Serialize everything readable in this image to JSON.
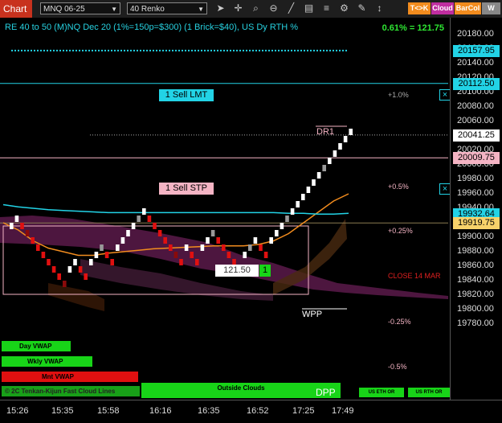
{
  "toolbar": {
    "chart_button": "Chart",
    "symbol": "MNQ 06-25",
    "chart_type": "40 Renko",
    "icons": [
      "pointer-icon",
      "crosshair-icon",
      "zoom-icon",
      "zoom-out-icon",
      "draw-line-icon",
      "template-icon",
      "properties-icon",
      "strategy-icon",
      "settings-icon",
      "fit-icon"
    ],
    "btn_tk": "T<>K",
    "btn_cloud": "Cloud",
    "btn_barcol": "BarCol",
    "btn_w": "W",
    "colors": {
      "tk": "#f28c1e",
      "cloud": "#c02ea0",
      "barcol": "#f28c1e",
      "w": "#888888"
    }
  },
  "header": {
    "title": "RE 40 to 50 (M)NQ Dec 20 (1%=150p=$300) (1 Brick=$40), US Dy RTH %",
    "percent": "0.61% = 121.75"
  },
  "y_axis": {
    "labels": [
      "20180.00",
      "20160.00",
      "20140.00",
      "20120.00",
      "20100.00",
      "20080.00",
      "20060.00",
      "20040.00",
      "20020.00",
      "20000.00",
      "19980.00",
      "19960.00",
      "19940.00",
      "19920.00",
      "19900.00",
      "19880.00",
      "19860.00",
      "19840.00",
      "19820.00",
      "19800.00",
      "19780.00"
    ],
    "highlight_labels": [
      {
        "text": "20157.95",
        "color": "#22d3e6"
      },
      {
        "text": "20112.50",
        "color": "#22d3e6"
      },
      {
        "text": "20041.25",
        "color": "#ffffff"
      },
      {
        "text": "20009.75",
        "color": "#f4b4c4"
      },
      {
        "text": "19932.64",
        "color": "#22d3e6"
      },
      {
        "text": "19919.75",
        "color": "#f7d26a"
      }
    ]
  },
  "x_axis": {
    "labels": [
      "15:26",
      "15:35",
      "15:58",
      "16:16",
      "16:35",
      "16:52",
      "17:25",
      "17:49"
    ]
  },
  "orders": {
    "sell_lmt": "1 Sell LMT",
    "sell_stp": "1 Sell STP",
    "close_x": "×",
    "pnl_value": "121.50",
    "qty": "1"
  },
  "annotations": {
    "dr1": "DR1",
    "wpp": "WPP",
    "dpp": "DPP",
    "p1": "+1.0%",
    "p05": "+0.5%",
    "p025": "+0.25%",
    "close": "CLOSE 14 MAR",
    "m025": "-0.25%",
    "m05": "-0.5%"
  },
  "indicators": {
    "day_vwap": "Day VWAP",
    "wkly_vwap": "Wkly VWAP",
    "mnt_vwap": "Mnt VWAP",
    "kijun": "© 2C Tenkan-Kijun Fast Cloud Lines",
    "outside_clouds": "Outside Clouds",
    "us_eth": "US ETH OR",
    "us_rth": "US RTH OR"
  },
  "chart_data": {
    "type": "renko",
    "brick_size": 10,
    "ylim": [
      19775,
      20190
    ],
    "bricks": [
      {
        "dir": "up",
        "top": 19920
      },
      {
        "dir": "up",
        "top": 19930
      },
      {
        "dir": "down",
        "top": 19920
      },
      {
        "dir": "down",
        "top": 19910
      },
      {
        "dir": "down",
        "top": 19900
      },
      {
        "dir": "down",
        "top": 19890
      },
      {
        "dir": "down",
        "top": 19880
      },
      {
        "dir": "down",
        "top": 19870
      },
      {
        "dir": "down",
        "top": 19860
      },
      {
        "dir": "down",
        "top": 19850
      },
      {
        "dir": "down",
        "top": 19840
      },
      {
        "dir": "up",
        "top": 19860
      },
      {
        "dir": "up",
        "top": 19870
      },
      {
        "dir": "down",
        "top": 19860
      },
      {
        "dir": "down",
        "top": 19850
      },
      {
        "dir": "up",
        "top": 19870
      },
      {
        "dir": "up",
        "top": 19880
      },
      {
        "dir": "up",
        "top": 19890
      },
      {
        "dir": "down",
        "top": 19880
      },
      {
        "dir": "down",
        "top": 19870
      },
      {
        "dir": "up",
        "top": 19890
      },
      {
        "dir": "up",
        "top": 19900
      },
      {
        "dir": "up",
        "top": 19910
      },
      {
        "dir": "up",
        "top": 19920
      },
      {
        "dir": "up",
        "top": 19930
      },
      {
        "dir": "up",
        "top": 19940
      },
      {
        "dir": "down",
        "top": 19930
      },
      {
        "dir": "down",
        "top": 19920
      },
      {
        "dir": "down",
        "top": 19910
      },
      {
        "dir": "down",
        "top": 19900
      },
      {
        "dir": "down",
        "top": 19890
      },
      {
        "dir": "down",
        "top": 19880
      },
      {
        "dir": "down",
        "top": 19870
      },
      {
        "dir": "up",
        "top": 19890
      },
      {
        "dir": "down",
        "top": 19880
      },
      {
        "dir": "down",
        "top": 19870
      },
      {
        "dir": "up",
        "top": 19890
      },
      {
        "dir": "up",
        "top": 19900
      },
      {
        "dir": "up",
        "top": 19910
      },
      {
        "dir": "down",
        "top": 19900
      },
      {
        "dir": "down",
        "top": 19890
      },
      {
        "dir": "down",
        "top": 19880
      },
      {
        "dir": "down",
        "top": 19870
      },
      {
        "dir": "down",
        "top": 19860
      },
      {
        "dir": "up",
        "top": 19880
      },
      {
        "dir": "up",
        "top": 19890
      },
      {
        "dir": "up",
        "top": 19900
      },
      {
        "dir": "down",
        "top": 19890
      },
      {
        "dir": "down",
        "top": 19880
      },
      {
        "dir": "up",
        "top": 19900
      },
      {
        "dir": "up",
        "top": 19910
      },
      {
        "dir": "up",
        "top": 19920
      },
      {
        "dir": "up",
        "top": 19930
      },
      {
        "dir": "up",
        "top": 19940
      },
      {
        "dir": "up",
        "top": 19950
      },
      {
        "dir": "up",
        "top": 19960
      },
      {
        "dir": "up",
        "top": 19970
      },
      {
        "dir": "up",
        "top": 19980
      },
      {
        "dir": "up",
        "top": 19990
      },
      {
        "dir": "up",
        "top": 20000
      },
      {
        "dir": "up",
        "top": 20010
      },
      {
        "dir": "up",
        "top": 20020
      },
      {
        "dir": "up",
        "top": 20030
      },
      {
        "dir": "up",
        "top": 20040
      },
      {
        "dir": "up",
        "top": 20050
      }
    ],
    "levels": [
      {
        "name": "cyan-dotted",
        "y": 20157.95,
        "color": "#22d3e6"
      },
      {
        "name": "sell-lmt",
        "y": 20112.5,
        "color": "#22d3e6"
      },
      {
        "name": "last-price",
        "y": 20041.25,
        "color": "#aaaaaa"
      },
      {
        "name": "sell-stp",
        "y": 20009.75,
        "color": "#f4b4c4"
      },
      {
        "name": "close",
        "y": 19919.75,
        "color": "#f7d26a"
      }
    ],
    "vwap": [
      19920,
      19910,
      19895,
      19885,
      19880,
      19875,
      19875,
      19878,
      19880,
      19882,
      19884,
      19885,
      19886,
      19887,
      19888,
      19888,
      19888,
      19890,
      19895,
      19905,
      19920,
      19935,
      19950,
      19960
    ],
    "cyan_ma": [
      19945,
      19942,
      19940,
      19938,
      19937,
      19936,
      19935,
      19934,
      19934,
      19934,
      19934,
      19934,
      19934,
      19934,
      19934,
      19934,
      19934,
      19934,
      19934,
      19933,
      19933,
      19932,
      19932,
      19933
    ]
  }
}
